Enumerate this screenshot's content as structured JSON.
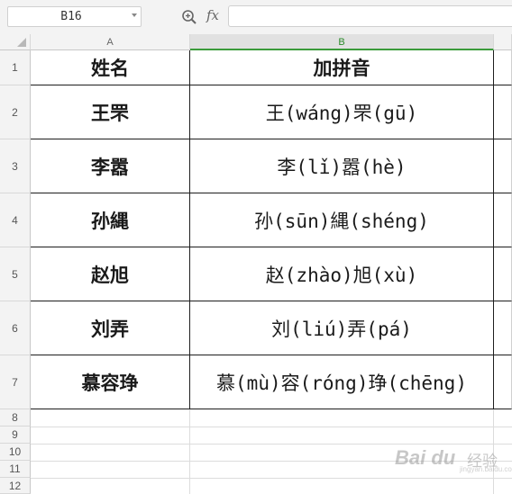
{
  "formula_bar": {
    "cell_reference": "B16",
    "fx_label": "fx",
    "formula_value": ""
  },
  "columns": [
    "A",
    "B"
  ],
  "rows": [
    "1",
    "2",
    "3",
    "4",
    "5",
    "6",
    "7",
    "8",
    "9",
    "10",
    "11",
    "12"
  ],
  "table": {
    "header": {
      "name": "姓名",
      "pinyin": "加拼音"
    },
    "rows": [
      {
        "name": "王罘",
        "pinyin": "王(wáng)罘(gū)"
      },
      {
        "name": "李嚣",
        "pinyin": "李(lǐ)嚣(hè)"
      },
      {
        "name": "孙縄",
        "pinyin": "孙(sūn)縄(shéng)"
      },
      {
        "name": "赵旭",
        "pinyin": "赵(zhào)旭(xù)"
      },
      {
        "name": "刘弄",
        "pinyin": "刘(liú)弄(pá)"
      },
      {
        "name": "慕容琤",
        "pinyin": "慕(mù)容(róng)琤(chēng)"
      }
    ]
  },
  "watermark": {
    "logo": "Bai du",
    "label": "经验",
    "url": "jingyan.baidu.com"
  },
  "colors": {
    "selected_column": "#3b9b3b",
    "grid": "#dcdcdc",
    "border": "#1e1e1e"
  }
}
